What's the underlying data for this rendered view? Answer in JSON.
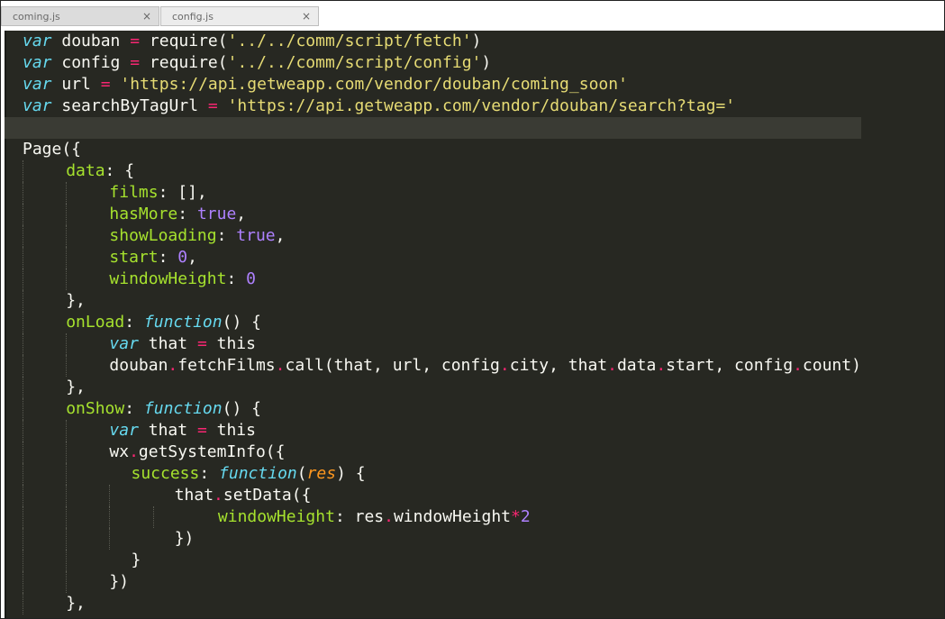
{
  "tabs": [
    {
      "label": "coming.js",
      "close": "×",
      "active": true
    },
    {
      "label": "config.js",
      "close": "×",
      "active": false
    }
  ],
  "theme": {
    "background": "#272822",
    "keyword": "#66d9ef",
    "string": "#e6db74",
    "property": "#a6e22e",
    "number": "#ae81ff",
    "operator": "#f92672",
    "argument": "#fd971f",
    "text": "#f8f8f2"
  },
  "code_lines": [
    {
      "indent": 0,
      "tokens": [
        [
          "k",
          "var"
        ],
        [
          "w",
          " douban "
        ],
        [
          "o",
          "="
        ],
        [
          "w",
          " require("
        ],
        [
          "s",
          "'../../comm/script/fetch'"
        ],
        [
          "w",
          ")"
        ]
      ]
    },
    {
      "indent": 0,
      "tokens": [
        [
          "k",
          "var"
        ],
        [
          "w",
          " config "
        ],
        [
          "o",
          "="
        ],
        [
          "w",
          " require("
        ],
        [
          "s",
          "'../../comm/script/config'"
        ],
        [
          "w",
          ")"
        ]
      ]
    },
    {
      "indent": 0,
      "tokens": [
        [
          "k",
          "var"
        ],
        [
          "w",
          " url "
        ],
        [
          "o",
          "="
        ],
        [
          "w",
          " "
        ],
        [
          "s",
          "'https://api.getweapp.com/vendor/douban/coming_soon'"
        ]
      ]
    },
    {
      "indent": 0,
      "tokens": [
        [
          "k",
          "var"
        ],
        [
          "w",
          " searchByTagUrl "
        ],
        [
          "o",
          "="
        ],
        [
          "w",
          " "
        ],
        [
          "s",
          "'https://api.getweapp.com/vendor/douban/search?tag='"
        ]
      ]
    },
    {
      "indent": 0,
      "highlight": true,
      "tokens": []
    },
    {
      "indent": 0,
      "tokens": [
        [
          "w",
          "Page({"
        ]
      ]
    },
    {
      "indent": 1,
      "tokens": [
        [
          "p",
          "data"
        ],
        [
          "w",
          ": {"
        ]
      ]
    },
    {
      "indent": 2,
      "tokens": [
        [
          "p",
          "films"
        ],
        [
          "w",
          ": [],"
        ]
      ]
    },
    {
      "indent": 2,
      "tokens": [
        [
          "p",
          "hasMore"
        ],
        [
          "w",
          ": "
        ],
        [
          "n",
          "true"
        ],
        [
          "w",
          ","
        ]
      ]
    },
    {
      "indent": 2,
      "tokens": [
        [
          "p",
          "showLoading"
        ],
        [
          "w",
          ": "
        ],
        [
          "n",
          "true"
        ],
        [
          "w",
          ","
        ]
      ]
    },
    {
      "indent": 2,
      "tokens": [
        [
          "p",
          "start"
        ],
        [
          "w",
          ": "
        ],
        [
          "n",
          "0"
        ],
        [
          "w",
          ","
        ]
      ]
    },
    {
      "indent": 2,
      "tokens": [
        [
          "p",
          "windowHeight"
        ],
        [
          "w",
          ": "
        ],
        [
          "n",
          "0"
        ]
      ]
    },
    {
      "indent": 1,
      "tokens": [
        [
          "w",
          "},"
        ]
      ]
    },
    {
      "indent": 1,
      "tokens": [
        [
          "p",
          "onLoad"
        ],
        [
          "w",
          ": "
        ],
        [
          "k",
          "function"
        ],
        [
          "w",
          "() {"
        ]
      ]
    },
    {
      "indent": 2,
      "tokens": [
        [
          "k",
          "var"
        ],
        [
          "w",
          " that "
        ],
        [
          "o",
          "="
        ],
        [
          "w",
          " this"
        ]
      ]
    },
    {
      "indent": 2,
      "tokens": [
        [
          "w",
          "douban"
        ],
        [
          "o",
          "."
        ],
        [
          "w",
          "fetchFilms"
        ],
        [
          "o",
          "."
        ],
        [
          "w",
          "call(that, url, config"
        ],
        [
          "o",
          "."
        ],
        [
          "w",
          "city, that"
        ],
        [
          "o",
          "."
        ],
        [
          "w",
          "data"
        ],
        [
          "o",
          "."
        ],
        [
          "w",
          "start, config"
        ],
        [
          "o",
          "."
        ],
        [
          "w",
          "count)"
        ]
      ]
    },
    {
      "indent": 1,
      "tokens": [
        [
          "w",
          "},"
        ]
      ]
    },
    {
      "indent": 1,
      "tokens": [
        [
          "p",
          "onShow"
        ],
        [
          "w",
          ": "
        ],
        [
          "k",
          "function"
        ],
        [
          "w",
          "() {"
        ]
      ]
    },
    {
      "indent": 2,
      "tokens": [
        [
          "k",
          "var"
        ],
        [
          "w",
          " that "
        ],
        [
          "o",
          "="
        ],
        [
          "w",
          " this"
        ]
      ]
    },
    {
      "indent": 2,
      "tokens": [
        [
          "w",
          "wx"
        ],
        [
          "o",
          "."
        ],
        [
          "w",
          "getSystemInfo({"
        ]
      ]
    },
    {
      "indent": 2.5,
      "tokens": [
        [
          "p",
          "success"
        ],
        [
          "w",
          ": "
        ],
        [
          "k",
          "function"
        ],
        [
          "w",
          "("
        ],
        [
          "ar",
          "res"
        ],
        [
          "w",
          ") {"
        ]
      ]
    },
    {
      "indent": 3.5,
      "tokens": [
        [
          "w",
          "that"
        ],
        [
          "o",
          "."
        ],
        [
          "w",
          "setData({"
        ]
      ]
    },
    {
      "indent": 4.5,
      "tokens": [
        [
          "p",
          "windowHeight"
        ],
        [
          "w",
          ": res"
        ],
        [
          "o",
          "."
        ],
        [
          "w",
          "windowHeight"
        ],
        [
          "o",
          "*"
        ],
        [
          "n",
          "2"
        ]
      ]
    },
    {
      "indent": 3.5,
      "tokens": [
        [
          "w",
          "})"
        ]
      ]
    },
    {
      "indent": 2.5,
      "tokens": [
        [
          "w",
          "}"
        ]
      ]
    },
    {
      "indent": 2,
      "tokens": [
        [
          "w",
          "})"
        ]
      ]
    },
    {
      "indent": 1,
      "tokens": [
        [
          "w",
          "},"
        ]
      ]
    }
  ]
}
